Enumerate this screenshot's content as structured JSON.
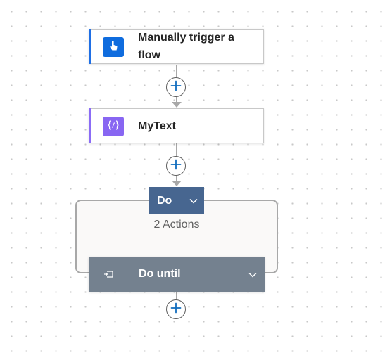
{
  "canvas": {
    "background": "#ffffff",
    "dot_color": "#c8c8c8"
  },
  "steps": [
    {
      "title": "Manually trigger a flow",
      "icon": "hand-tap-icon",
      "accent_color": "#1f6fe5",
      "icon_bg": "#0f6cde"
    },
    {
      "title": "MyText",
      "icon": "variable-braces-icon",
      "accent_color": "#8b6cf6",
      "icon_bg": "#8866f2"
    }
  ],
  "scope": {
    "header_label": "Do",
    "header_color": "#476690",
    "action_count": "2 Actions"
  },
  "until": {
    "label": "Do until",
    "icon": "loop-icon",
    "bar_color": "#74818f"
  },
  "add_button": {
    "icon": "plus-icon",
    "color": "#0f6cbd"
  }
}
